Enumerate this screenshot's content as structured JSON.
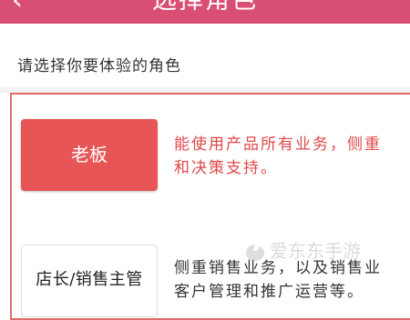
{
  "header": {
    "back_icon": "chevron-left-icon",
    "title": "选择角色"
  },
  "prompt": "请选择你要体验的角色",
  "roles": [
    {
      "label": "老板",
      "description": "能使用产品所有业务，侧重\n和决策支持。",
      "selected": true
    },
    {
      "label": "店长/销售主管",
      "description": "侧重销售业务，以及销售业\n客户管理和推广运营等。",
      "selected": false
    }
  ],
  "watermark": "爱东东手游",
  "colors": {
    "header_bg": "#d94f74",
    "selected_button": "#e85556",
    "selected_border": "#e26a6a",
    "selected_text": "#e04848"
  }
}
